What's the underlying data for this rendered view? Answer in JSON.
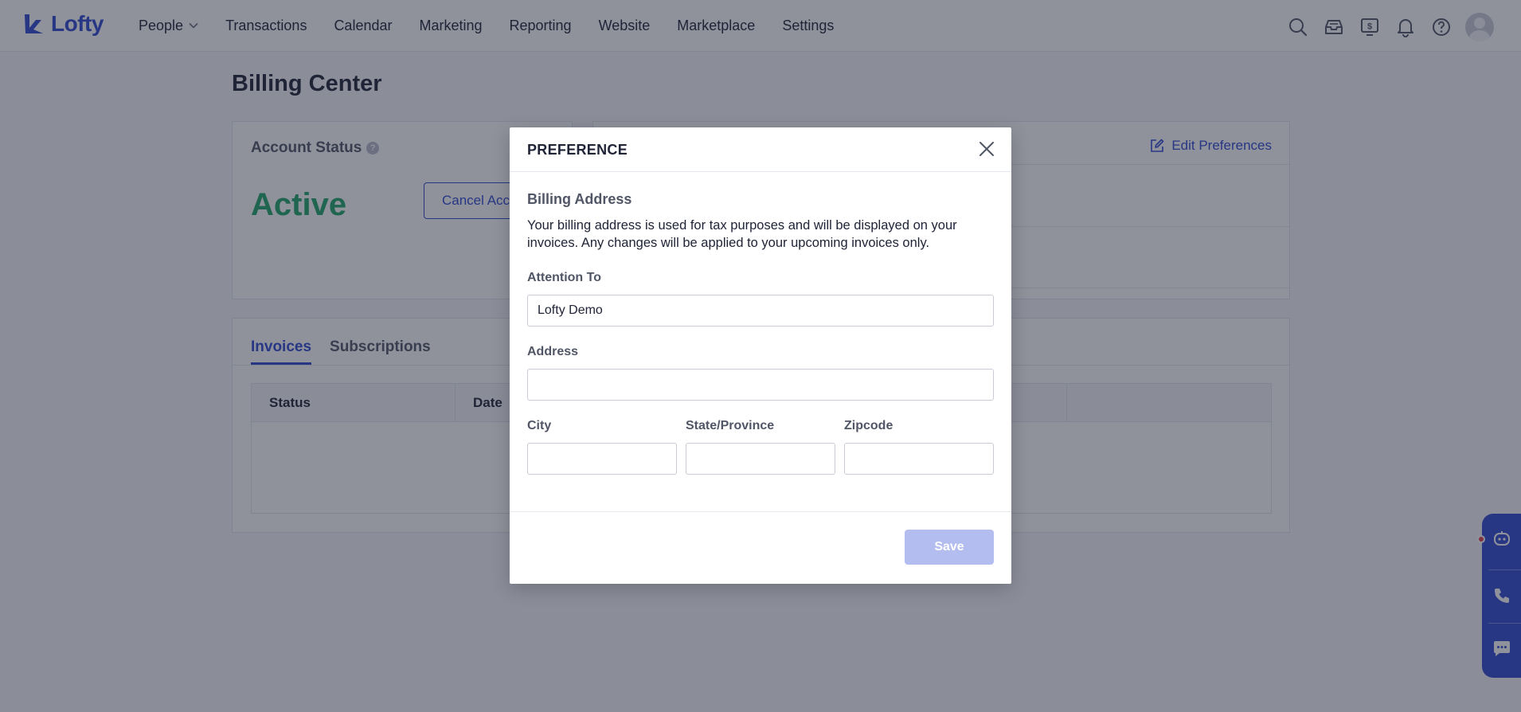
{
  "app": {
    "logo_text": "Lofty"
  },
  "nav": {
    "items": [
      "People",
      "Transactions",
      "Calendar",
      "Marketing",
      "Reporting",
      "Website",
      "Marketplace",
      "Settings"
    ]
  },
  "page": {
    "title": "Billing Center",
    "account_status_label": "Account Status",
    "account_status_value": "Active",
    "cancel_button": "Cancel Account",
    "edit_preferences": "Edit Preferences",
    "tabs": [
      "Invoices",
      "Subscriptions"
    ],
    "table_headers": [
      "Status",
      "Date"
    ]
  },
  "modal": {
    "title": "PREFERENCE",
    "section_title": "Billing Address",
    "description": "Your billing address is used for tax purposes and will be displayed on your invoices. Any changes will be applied to your upcoming invoices only.",
    "attention_label": "Attention To",
    "attention_value": "Lofty Demo",
    "address_label": "Address",
    "address_value": "",
    "city_label": "City",
    "city_value": "",
    "state_label": "State/Province",
    "state_value": "",
    "zip_label": "Zipcode",
    "zip_value": "",
    "save_button": "Save"
  },
  "colors": {
    "brand": "#2f4ad0",
    "active_status": "#20a767",
    "save_disabled": "#b3bdf0"
  }
}
